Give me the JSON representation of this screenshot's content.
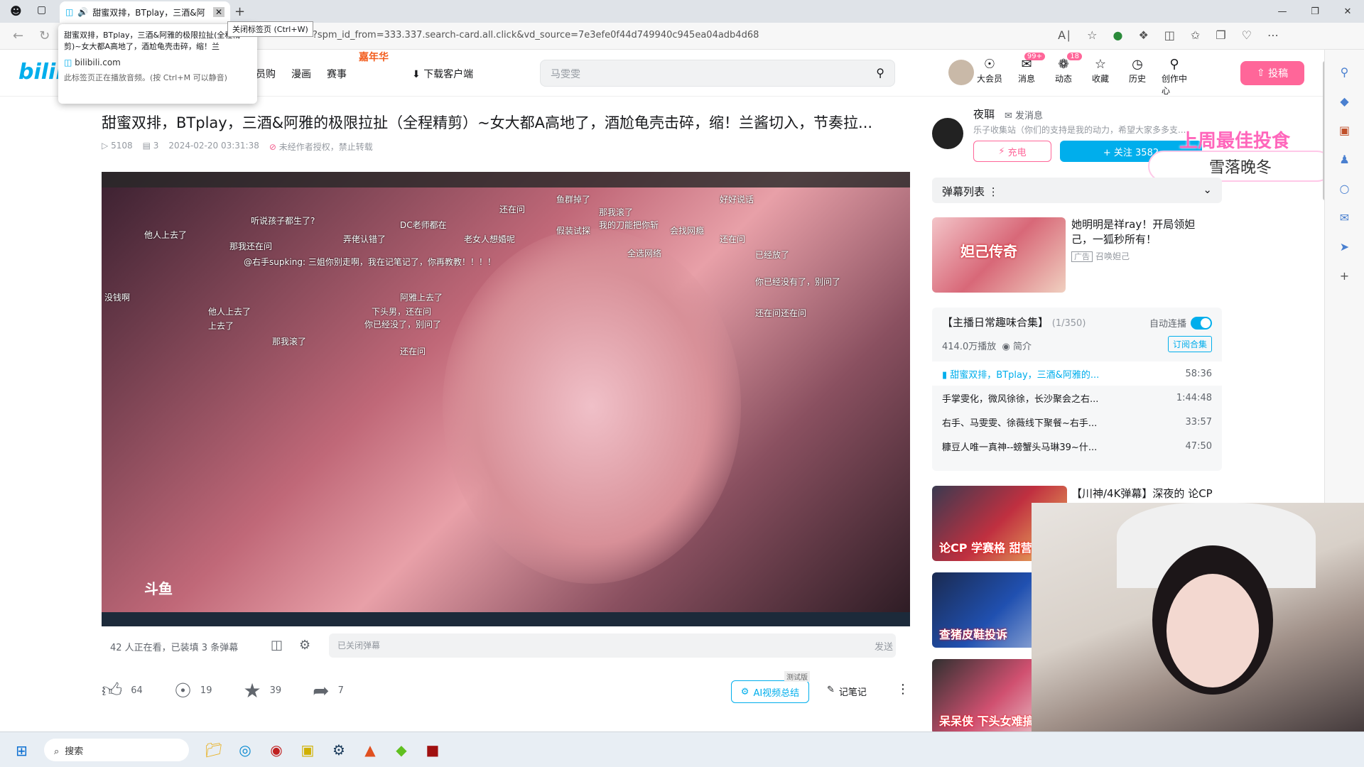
{
  "browser": {
    "tab_title": "甜蜜双排，BTplay，三酒&阿",
    "close_tooltip": "关闭标签页 (Ctrl+W)",
    "preview_title": "甜蜜双排，BTplay，三酒&阿雅的极限拉扯(全程精剪)~女大都A高地了，酒尬龟壳击碎，缩！兰",
    "preview_domain": "bilibili.com",
    "preview_note": "此标签页正在播放音频。(按 Ctrl+M 可以静音)",
    "url": "?spm_id_from=333.337.search-card.all.click&vd_source=7e3efe0f44d749940c945ea04adb4d68"
  },
  "header": {
    "logo": "bilibili",
    "nav": [
      "员购",
      "漫画",
      "赛事"
    ],
    "festival": "嘉年华",
    "download": "下载客户端",
    "search_placeholder": "马雯雯",
    "icons": [
      {
        "label": "大会员",
        "icon": "vip-icon",
        "badge": ""
      },
      {
        "label": "消息",
        "icon": "message-icon",
        "badge": "99+"
      },
      {
        "label": "动态",
        "icon": "dynamic-icon",
        "badge": "18"
      },
      {
        "label": "收藏",
        "icon": "star-icon",
        "badge": ""
      },
      {
        "label": "历史",
        "icon": "clock-icon",
        "badge": ""
      },
      {
        "label": "创作中心",
        "icon": "bulb-icon",
        "badge": ""
      }
    ],
    "upload": "投稿"
  },
  "video": {
    "title": "甜蜜双排，BTplay，三酒&阿雅的极限拉扯（全程精剪）~女大都A高地了，酒尬龟壳击碎，缩！兰酱切入，节奏拉...",
    "views": "5108",
    "danmaku": "3",
    "date": "2024-02-20 03:31:38",
    "rights": "未经作者授权，禁止转载",
    "watching": "42 人正在看，已装填 3 条弹幕",
    "danmaku_placeholder": "已关闭弹幕",
    "send": "发送",
    "likes": "64",
    "coins": "19",
    "favorites": "39",
    "shares": "7",
    "ai_summary": "AI视频总结",
    "beta": "测试版",
    "notes": "记笔记",
    "watermark": "斗鱼",
    "danmaku_samples": [
      "听说孩子都生了?",
      "还在问",
      "那我滚了",
      "弄佬认错了",
      "那我还在问",
      "DC老师都在",
      "他人上去了",
      "我的刀能把你斩",
      "@右手supking: 三姐你别走啊，我在记笔记了，你再教教！！！！",
      "还在问",
      "鱼群掉了",
      "好好说话",
      "已经放了",
      "下头男，还在问",
      "老女人想婚呢",
      "会找网瘾",
      "全选网络",
      "假装试探",
      "你已经没有了，别问了",
      "没钱啊",
      "阿雅上去了",
      "他人上去了",
      "还在问",
      "那我滚了",
      "还在问还在问",
      "上去了",
      "你已经没了，别问了"
    ]
  },
  "up": {
    "name": "夜聑",
    "message": "发消息",
    "sign": "乐子收集站（你们的支持是我的动力，希望大家多多支...",
    "charge": "充电",
    "follow": "+ 关注 3582"
  },
  "overlay": {
    "title": "上周最佳投食",
    "name": "雪落晚冬"
  },
  "danmaku_list": "弹幕列表",
  "ad": {
    "title": "她明明是祥ray！开局领妲己，一狐秒所有！",
    "tag": "广告",
    "source": "召唤妲己",
    "thumb_text": "妲己传奇"
  },
  "collection": {
    "title": "【主播日常趣味合集】",
    "count": "(1/350)",
    "auto": "自动连播",
    "plays": "414.0万播放",
    "intro": "简介",
    "subscribe": "订阅合集",
    "items": [
      {
        "title": "甜蜜双排，BTplay，三酒&阿雅的...",
        "duration": "58:36"
      },
      {
        "title": "手掌雯化，微风徐徐，长沙聚会之右...",
        "duration": "1:44:48"
      },
      {
        "title": "右手、马雯雯、徐薇线下聚餐~右手...",
        "duration": "33:57"
      },
      {
        "title": "糠豆人唯一真神--螃蟹头马琳39~什...",
        "duration": "47:50"
      }
    ]
  },
  "recommend": {
    "title": "【川神/4K弹幕】深夜的 论CP",
    "thumbs": [
      "论CP 学赛格 甜营销",
      "查猪皮鞋投诉",
      "呆呆侠 下头女难搞"
    ]
  },
  "taskbar": {
    "search": "搜索"
  }
}
